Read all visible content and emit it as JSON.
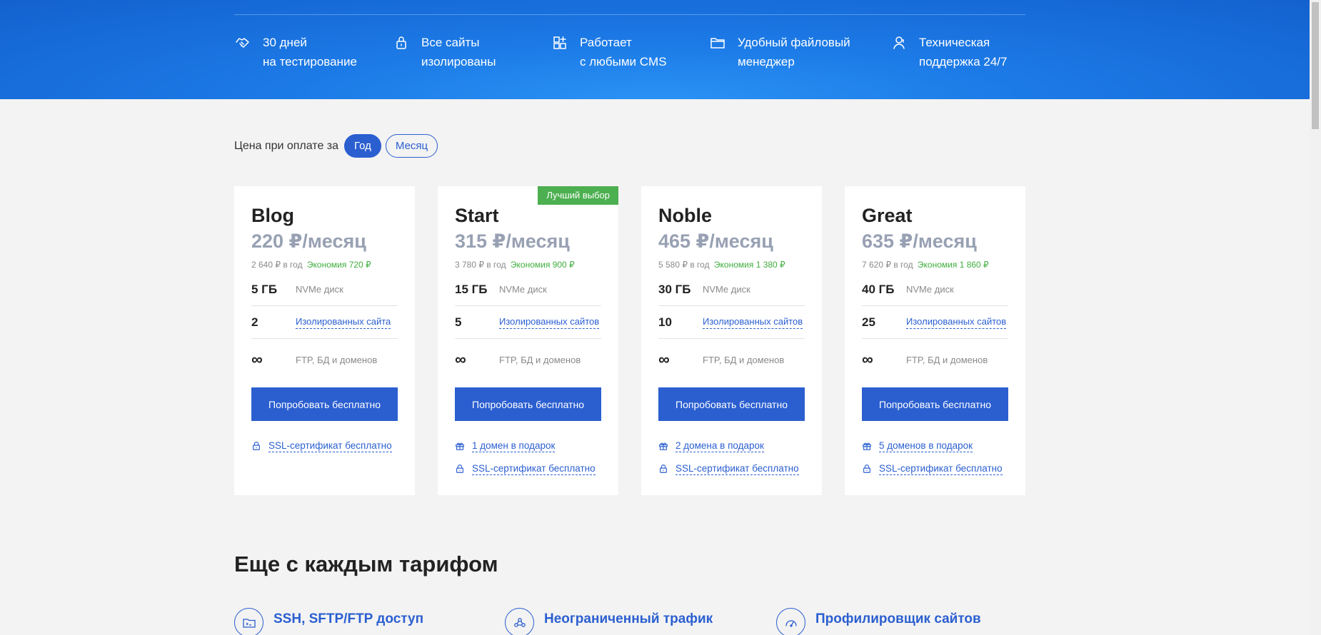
{
  "features": [
    {
      "icon": "handshake-icon",
      "line1": "30 дней",
      "line2": "на тестирование"
    },
    {
      "icon": "lock-icon",
      "line1": "Все сайты",
      "line2": "изолированы"
    },
    {
      "icon": "blocks-icon",
      "line1": "Работает",
      "line2": "с любыми CMS"
    },
    {
      "icon": "folder-icon",
      "line1": "Удобный файловый",
      "line2": "менеджер"
    },
    {
      "icon": "support-person-icon",
      "line1": "Техническая",
      "line2": "поддержка 24/7"
    }
  ],
  "billing": {
    "label": "Цена при оплате за",
    "options": [
      "Год",
      "Месяц"
    ],
    "selected": "Год"
  },
  "plans": [
    {
      "name": "Blog",
      "price": "220 ₽/месяц",
      "year": "2 640 ₽ в год",
      "save": "Экономия 720 ₽",
      "disk_value": "5 ГБ",
      "disk_label": "NVMe диск",
      "sites_value": "2",
      "sites_label": "Изолированных сайта",
      "ftp_value": "∞",
      "ftp_label": "FTP, БД и доменов",
      "button": "Попробовать бесплатно",
      "extras": [
        {
          "icon": "lock-icon",
          "text": "SSL-сертификат бесплатно"
        }
      ]
    },
    {
      "name": "Start",
      "badge": "Лучший выбор",
      "price": "315 ₽/месяц",
      "year": "3 780 ₽ в год",
      "save": "Экономия 900 ₽",
      "disk_value": "15 ГБ",
      "disk_label": "NVMe диск",
      "sites_value": "5",
      "sites_label": "Изолированных сайтов",
      "ftp_value": "∞",
      "ftp_label": "FTP, БД и доменов",
      "button": "Попробовать бесплатно",
      "extras": [
        {
          "icon": "gift-icon",
          "text": "1 домен в подарок"
        },
        {
          "icon": "lock-icon",
          "text": "SSL-сертификат бесплатно"
        }
      ]
    },
    {
      "name": "Noble",
      "price": "465 ₽/месяц",
      "year": "5 580 ₽ в год",
      "save": "Экономия 1 380 ₽",
      "disk_value": "30 ГБ",
      "disk_label": "NVMe диск",
      "sites_value": "10",
      "sites_label": "Изолированных сайтов",
      "ftp_value": "∞",
      "ftp_label": "FTP, БД и доменов",
      "button": "Попробовать бесплатно",
      "extras": [
        {
          "icon": "gift-icon",
          "text": "2 домена в подарок"
        },
        {
          "icon": "lock-icon",
          "text": "SSL-сертификат бесплатно"
        }
      ]
    },
    {
      "name": "Great",
      "price": "635 ₽/месяц",
      "year": "7 620 ₽ в год",
      "save": "Экономия 1 860 ₽",
      "disk_value": "40 ГБ",
      "disk_label": "NVMe диск",
      "sites_value": "25",
      "sites_label": "Изолированных сайтов",
      "ftp_value": "∞",
      "ftp_label": "FTP, БД и доменов",
      "button": "Попробовать бесплатно",
      "extras": [
        {
          "icon": "gift-icon",
          "text": "5 доменов в подарок"
        },
        {
          "icon": "lock-icon",
          "text": "SSL-сертификат бесплатно"
        }
      ]
    }
  ],
  "section": {
    "title": "Еще с каждым тарифом",
    "perks": [
      {
        "icon": "folder-terminal-icon",
        "text": "SSH, SFTP/FTP доступ"
      },
      {
        "icon": "network-icon",
        "text": "Неограниченный трафик"
      },
      {
        "icon": "gauge-icon",
        "text": "Профилировщик сайтов"
      }
    ]
  },
  "colors": {
    "accent": "#2b5fd0",
    "badge": "#4caf50",
    "save": "#3fae3f",
    "hero": "#1c7ae6"
  }
}
